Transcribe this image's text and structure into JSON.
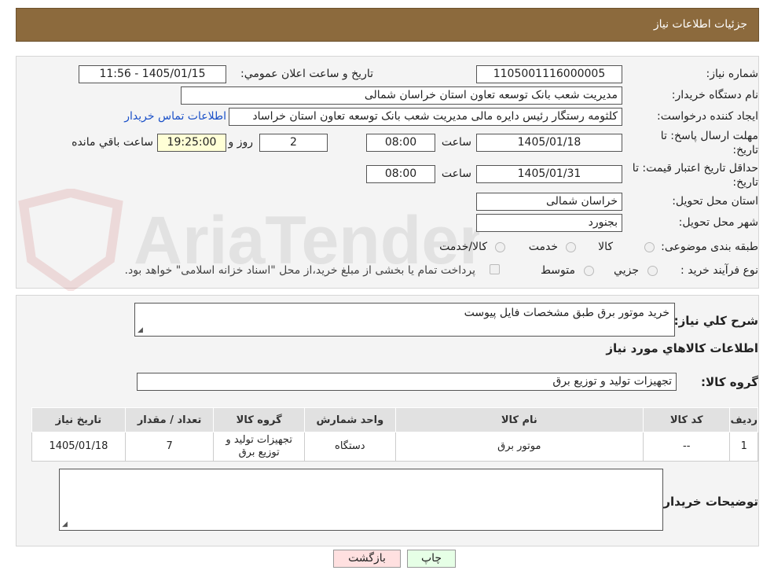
{
  "header": {
    "title": "جزئیات اطلاعات نیاز"
  },
  "form": {
    "need_number": {
      "label": "شماره نیاز:",
      "value": "1105001116000005"
    },
    "announce_datetime": {
      "label": "تاریخ و ساعت اعلان عمومي:",
      "value": "1405/01/15 - 11:56"
    },
    "buyer_org": {
      "label": "نام دستگاه خريدار:",
      "value": "مدیریت شعب بانک توسعه تعاون استان خراسان شمالی"
    },
    "requester": {
      "label": "ايجاد کننده درخواست:",
      "value": "کلثومه رستگار رئیس دایره مالی مدیریت شعب بانک توسعه تعاون استان خراساد",
      "contact_link": "اطلاعات تماس خریدار"
    },
    "reply_deadline": {
      "label_line1": "مهلت ارسال پاسخ: تا",
      "label_line2": "تاريخ:",
      "date": "1405/01/18",
      "time_label": "ساعت",
      "time": "08:00",
      "days": "2",
      "days_label": "روز و",
      "remaining": "19:25:00",
      "remaining_label": "ساعت باقي مانده"
    },
    "price_validity": {
      "label_line1": "حداقل تاريخ اعتبار قيمت: تا",
      "label_line2": "تاريخ:",
      "date": "1405/01/31",
      "time_label": "ساعت",
      "time": "08:00"
    },
    "delivery_province": {
      "label": "استان محل تحويل:",
      "value": "خراسان شمالی"
    },
    "delivery_city": {
      "label": "شهر محل تحويل:",
      "value": "بجنورد"
    },
    "category": {
      "label": "طبقه بندی موضوعی:",
      "options": [
        "کالا",
        "خدمت",
        "کالا/خدمت"
      ]
    },
    "purchase_type": {
      "label": "نوع فرآيند خريد :",
      "options": [
        "جزيي",
        "متوسط"
      ],
      "note": "پرداخت تمام يا بخشی از مبلغ خريد،از محل \"اسناد خزانه اسلامی\" خواهد بود."
    }
  },
  "details": {
    "description_label": "شرح کلي نياز:",
    "description": "خرید موتور برق طبق مشخصات فایل پیوست",
    "items_title": "اطلاعات کالاهاي مورد نياز",
    "group_label": "گروه کالا:",
    "group_value": "تجهیزات تولید و توزیع برق",
    "table": {
      "headers": [
        "رديف",
        "کد کالا",
        "نام کالا",
        "واحد شمارش",
        "گروه کالا",
        "تعداد / مقدار",
        "تاريخ نياز"
      ],
      "rows": [
        [
          "1",
          "--",
          "موتور برق",
          "دستگاه",
          "تجهیزات تولید و توزیع برق",
          "7",
          "1405/01/18"
        ]
      ]
    },
    "buyer_notes_label": "توضيحات خريدار:",
    "buyer_notes": ""
  },
  "buttons": {
    "print": "چاپ",
    "back": "بازگشت"
  },
  "watermark": {
    "text": "AriaTender.neT"
  },
  "colors": {
    "header": "#8c6a3d",
    "link": "#1a50c8",
    "highlight": "#ffffd6",
    "back_button": "#ffe0e0",
    "print_button": "#e6ffe6"
  }
}
